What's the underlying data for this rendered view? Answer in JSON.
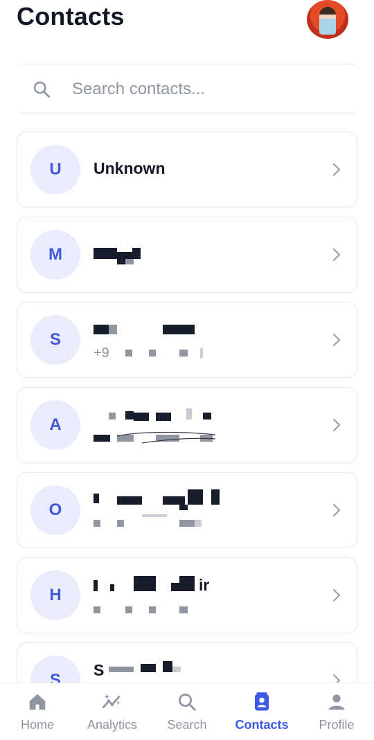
{
  "header": {
    "title": "Contacts"
  },
  "search": {
    "placeholder": "Search contacts..."
  },
  "contacts": [
    {
      "initial": "U",
      "name": "Unknown"
    },
    {
      "initial": "M"
    },
    {
      "initial": "S",
      "phone_prefix": "+9"
    },
    {
      "initial": "A"
    },
    {
      "initial": "O"
    },
    {
      "initial": "H",
      "name_suffix": "ir"
    },
    {
      "initial": "S",
      "name_prefix": "S"
    }
  ],
  "nav": {
    "items": [
      {
        "label": "Home",
        "icon": "home-icon"
      },
      {
        "label": "Analytics",
        "icon": "analytics-icon"
      },
      {
        "label": "Search",
        "icon": "search-icon"
      },
      {
        "label": "Contacts",
        "icon": "contacts-icon",
        "active": true
      },
      {
        "label": "Profile",
        "icon": "profile-icon"
      }
    ]
  },
  "colors": {
    "accent": "#3b59e6",
    "avatar_bg": "#e9edfb",
    "text": "#121826",
    "muted": "#8f95a1"
  }
}
